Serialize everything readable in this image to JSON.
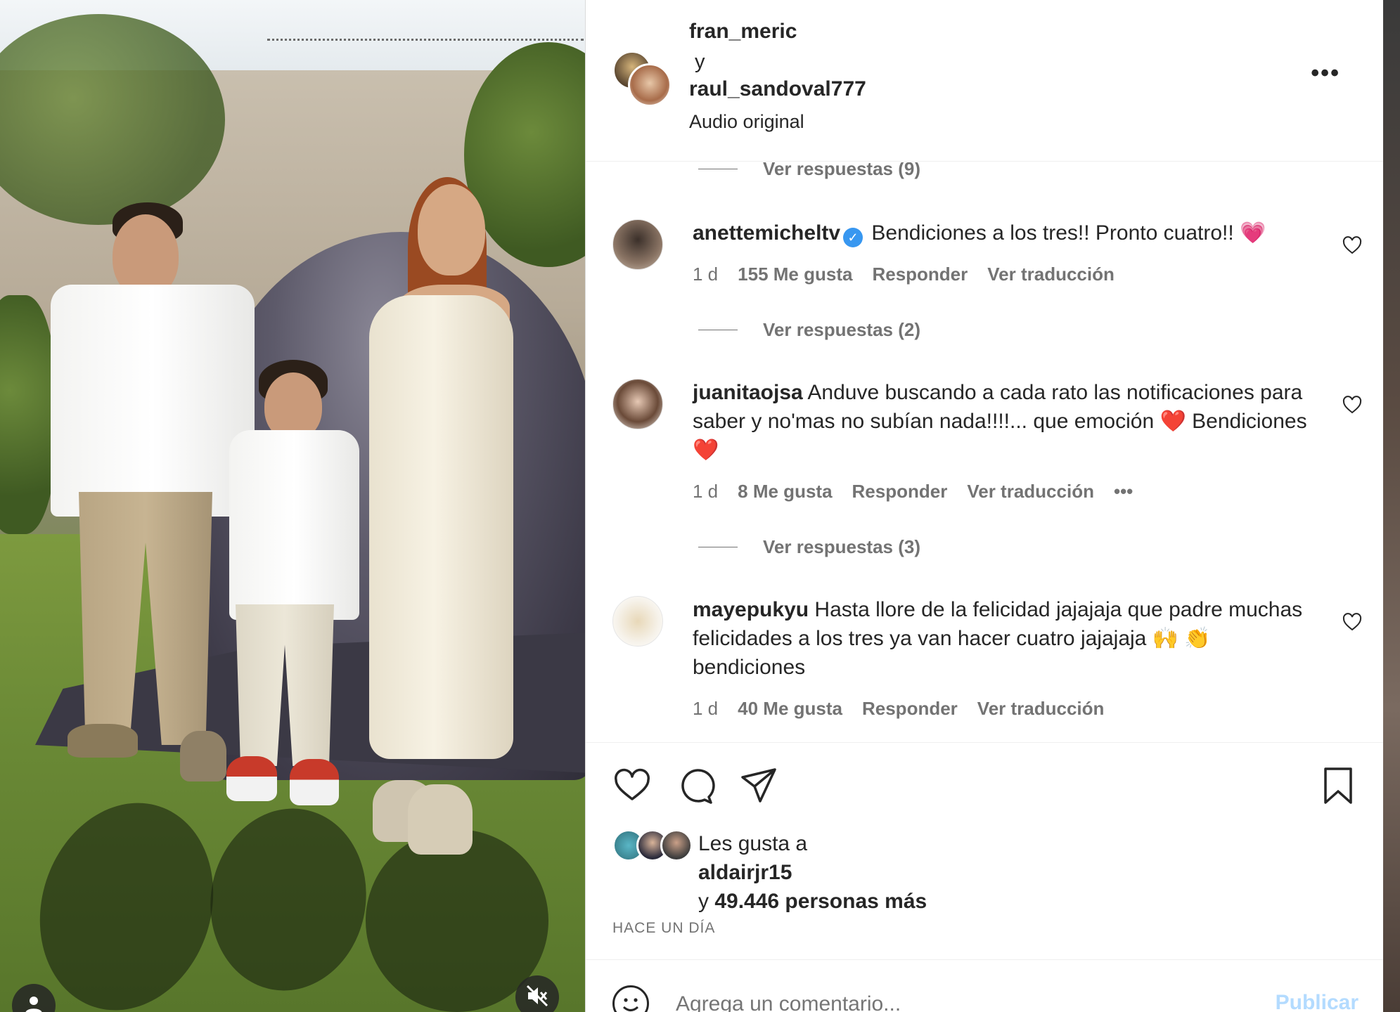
{
  "header": {
    "user1": "fran_meric",
    "connector": "y",
    "user2": "raul_sandoval777",
    "audio": "Audio original",
    "more_icon": "more-horizontal-icon"
  },
  "comments": {
    "top_replies": "Ver respuestas (9)",
    "items": [
      {
        "username": "anettemicheltv",
        "verified": true,
        "text": "Bendiciones a los tres!! Pronto cuatro!! 💗",
        "time": "1 d",
        "likes": "155 Me gusta",
        "reply": "Responder",
        "translate": "Ver traducción",
        "replies": "Ver respuestas (2)"
      },
      {
        "username": "juanitaojsa",
        "verified": false,
        "text": "Anduve buscando a cada rato las notificaciones para saber y no'mas no subían nada!!!!... que emoción ❤️ Bendiciones ❤️",
        "time": "1 d",
        "likes": "8 Me gusta",
        "reply": "Responder",
        "translate": "Ver traducción",
        "more": "•••",
        "replies": "Ver respuestas (3)"
      },
      {
        "username": "mayepukyu",
        "verified": false,
        "text": "Hasta llore de la felicidad jajajaja que padre muchas felicidades a los tres ya van hacer cuatro jajajaja 🙌 👏 bendiciones",
        "time": "1 d",
        "likes": "40 Me gusta",
        "reply": "Responder",
        "translate": "Ver traducción"
      }
    ]
  },
  "actions": {
    "like_icon": "heart-icon",
    "comment_icon": "comment-icon",
    "share_icon": "send-icon",
    "save_icon": "bookmark-icon"
  },
  "likes": {
    "prefix": "Les gusta a",
    "user": "aldairjr15",
    "connector": "y",
    "others": "49.446 personas más"
  },
  "timestamp": "HACE UN DÍA",
  "add_comment": {
    "placeholder": "Agrega un comentario...",
    "publish": "Publicar"
  },
  "colors": {
    "link_disabled": "#b3dbff",
    "verified": "#3897f0",
    "muted_text": "#737373"
  }
}
